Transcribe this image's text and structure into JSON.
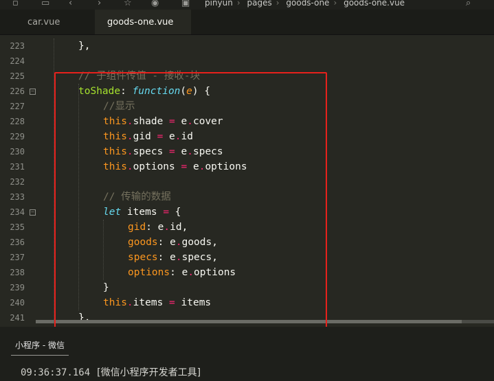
{
  "breadcrumb": [
    "pinyun",
    "pages",
    "goods-one",
    "goods-one.vue"
  ],
  "tabs": [
    {
      "label": "car.vue",
      "active": false
    },
    {
      "label": "goods-one.vue",
      "active": true
    }
  ],
  "line_numbers": [
    "223",
    "224",
    "225",
    "226",
    "227",
    "228",
    "229",
    "230",
    "231",
    "232",
    "233",
    "234",
    "235",
    "236",
    "237",
    "238",
    "239",
    "240",
    "241"
  ],
  "code_lines": [
    [
      {
        "t": "p",
        "v": "},"
      }
    ],
    [],
    [
      {
        "t": "c",
        "v": "// 子组件传值 - 接收-块"
      }
    ],
    [
      {
        "t": "fn",
        "v": "toShade"
      },
      {
        "t": "p",
        "v": ": "
      },
      {
        "t": "kw",
        "v": "function"
      },
      {
        "t": "p",
        "v": "("
      },
      {
        "t": "pr",
        "v": "e"
      },
      {
        "t": "p",
        "v": ") {"
      }
    ],
    [
      {
        "t": "c",
        "v": "//显示"
      }
    ],
    [
      {
        "t": "th",
        "v": "this"
      },
      {
        "t": "k",
        "v": "."
      },
      {
        "t": "p",
        "v": "shade "
      },
      {
        "t": "k",
        "v": "="
      },
      {
        "t": "p",
        "v": " e"
      },
      {
        "t": "k",
        "v": "."
      },
      {
        "t": "p",
        "v": "cover"
      }
    ],
    [
      {
        "t": "th",
        "v": "this"
      },
      {
        "t": "k",
        "v": "."
      },
      {
        "t": "p",
        "v": "gid "
      },
      {
        "t": "k",
        "v": "="
      },
      {
        "t": "p",
        "v": " e"
      },
      {
        "t": "k",
        "v": "."
      },
      {
        "t": "p",
        "v": "id"
      }
    ],
    [
      {
        "t": "th",
        "v": "this"
      },
      {
        "t": "k",
        "v": "."
      },
      {
        "t": "p",
        "v": "specs "
      },
      {
        "t": "k",
        "v": "="
      },
      {
        "t": "p",
        "v": " e"
      },
      {
        "t": "k",
        "v": "."
      },
      {
        "t": "p",
        "v": "specs"
      }
    ],
    [
      {
        "t": "th",
        "v": "this"
      },
      {
        "t": "k",
        "v": "."
      },
      {
        "t": "p",
        "v": "options "
      },
      {
        "t": "k",
        "v": "="
      },
      {
        "t": "p",
        "v": " e"
      },
      {
        "t": "k",
        "v": "."
      },
      {
        "t": "p",
        "v": "options"
      }
    ],
    [],
    [
      {
        "t": "c",
        "v": "// 传输的数据"
      }
    ],
    [
      {
        "t": "kw",
        "v": "let"
      },
      {
        "t": "p",
        "v": " items "
      },
      {
        "t": "k",
        "v": "="
      },
      {
        "t": "p",
        "v": " {"
      }
    ],
    [
      {
        "t": "th",
        "v": "gid"
      },
      {
        "t": "p",
        "v": ": e"
      },
      {
        "t": "k",
        "v": "."
      },
      {
        "t": "p",
        "v": "id,"
      }
    ],
    [
      {
        "t": "th",
        "v": "goods"
      },
      {
        "t": "p",
        "v": ": e"
      },
      {
        "t": "k",
        "v": "."
      },
      {
        "t": "p",
        "v": "goods,"
      }
    ],
    [
      {
        "t": "th",
        "v": "specs"
      },
      {
        "t": "p",
        "v": ": e"
      },
      {
        "t": "k",
        "v": "."
      },
      {
        "t": "p",
        "v": "specs,"
      }
    ],
    [
      {
        "t": "th",
        "v": "options"
      },
      {
        "t": "p",
        "v": ": e"
      },
      {
        "t": "k",
        "v": "."
      },
      {
        "t": "p",
        "v": "options"
      }
    ],
    [
      {
        "t": "p",
        "v": "}"
      }
    ],
    [
      {
        "t": "th",
        "v": "this"
      },
      {
        "t": "k",
        "v": "."
      },
      {
        "t": "p",
        "v": "items "
      },
      {
        "t": "k",
        "v": "="
      },
      {
        "t": "p",
        "v": " items"
      }
    ],
    [
      {
        "t": "p",
        "v": "},"
      }
    ]
  ],
  "console": {
    "title": "小程序 - 微信",
    "timestamp": "09:36:37.164",
    "message": "[微信小程序开发者工具]"
  },
  "colors": {
    "background": "#272822",
    "highlight_box": "#e8211c"
  },
  "icons": [
    "save-icon",
    "back-icon",
    "forward-icon",
    "star-icon",
    "run-icon",
    "file-icon",
    "search-icon"
  ]
}
